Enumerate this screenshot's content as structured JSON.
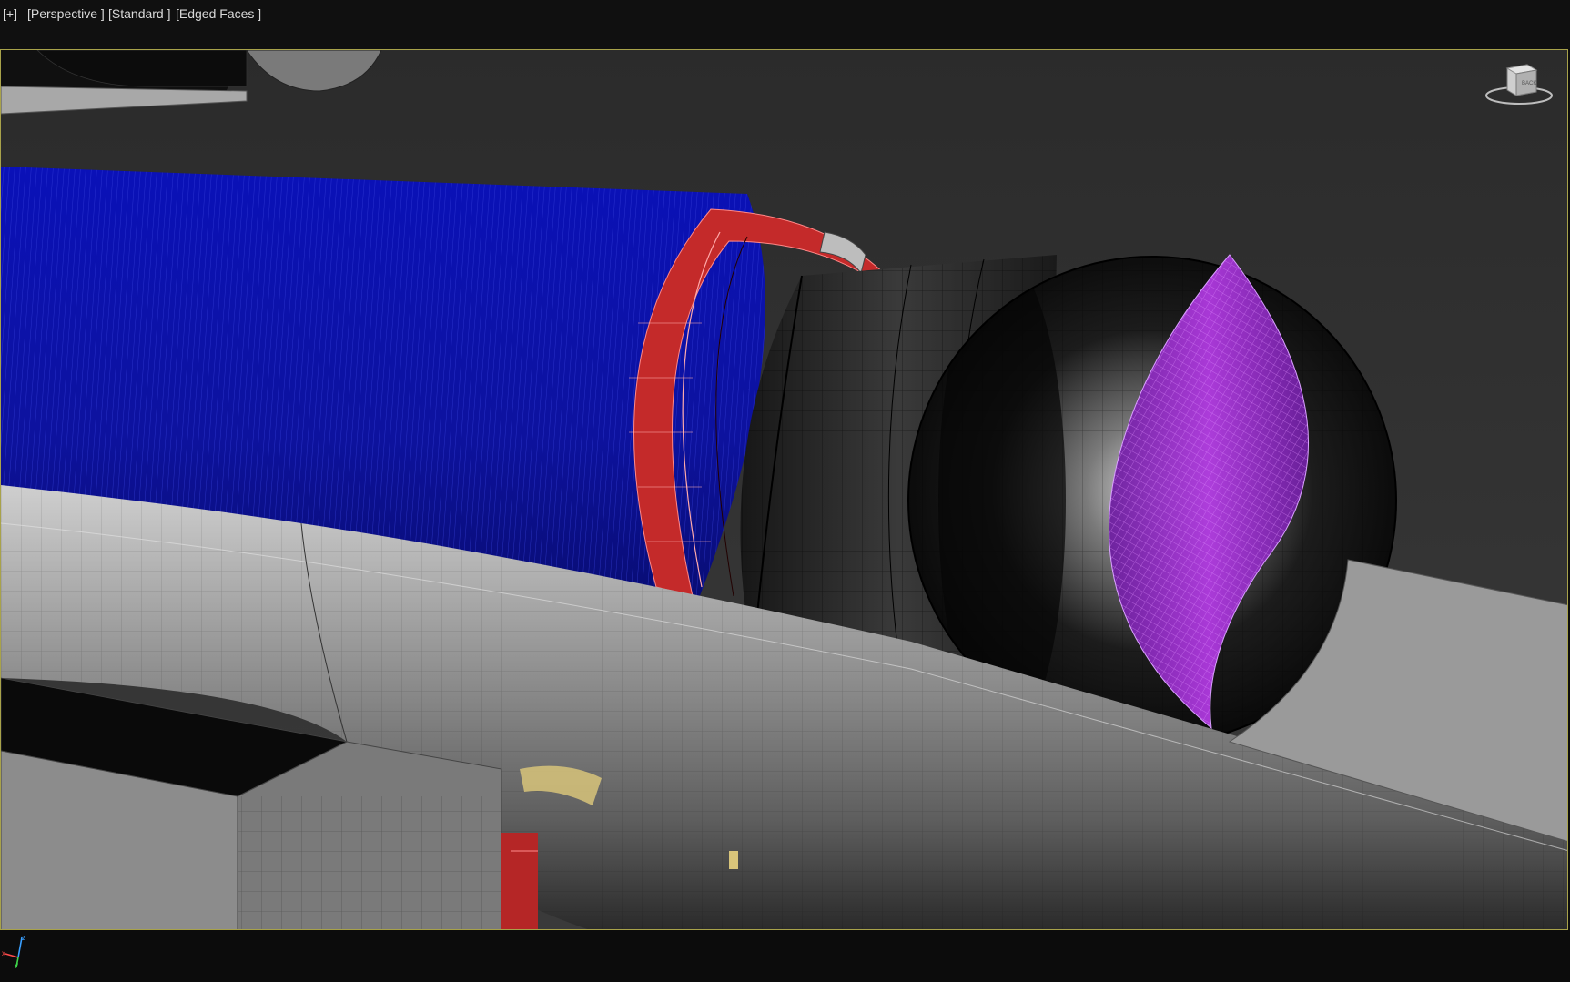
{
  "viewport": {
    "labels": {
      "menu": "[+]",
      "view": "[Perspective ]",
      "shading": "[Standard ]",
      "edges": "[Edged Faces ]"
    },
    "viewcube_face": "BACK",
    "axis": {
      "x": "x",
      "y": "y",
      "z": "z"
    }
  },
  "colors": {
    "frame_border": "#a8a24a",
    "background": "#303030",
    "blue_mesh": "#0a0fa8",
    "red_mesh": "#c42a2a",
    "purple_mesh": "#9a2fc8",
    "gray_mesh": "#8a8a8a",
    "black_mesh": "#111111"
  },
  "icons": {
    "viewcube": "viewcube-icon",
    "axis": "axis-tripod-icon"
  }
}
